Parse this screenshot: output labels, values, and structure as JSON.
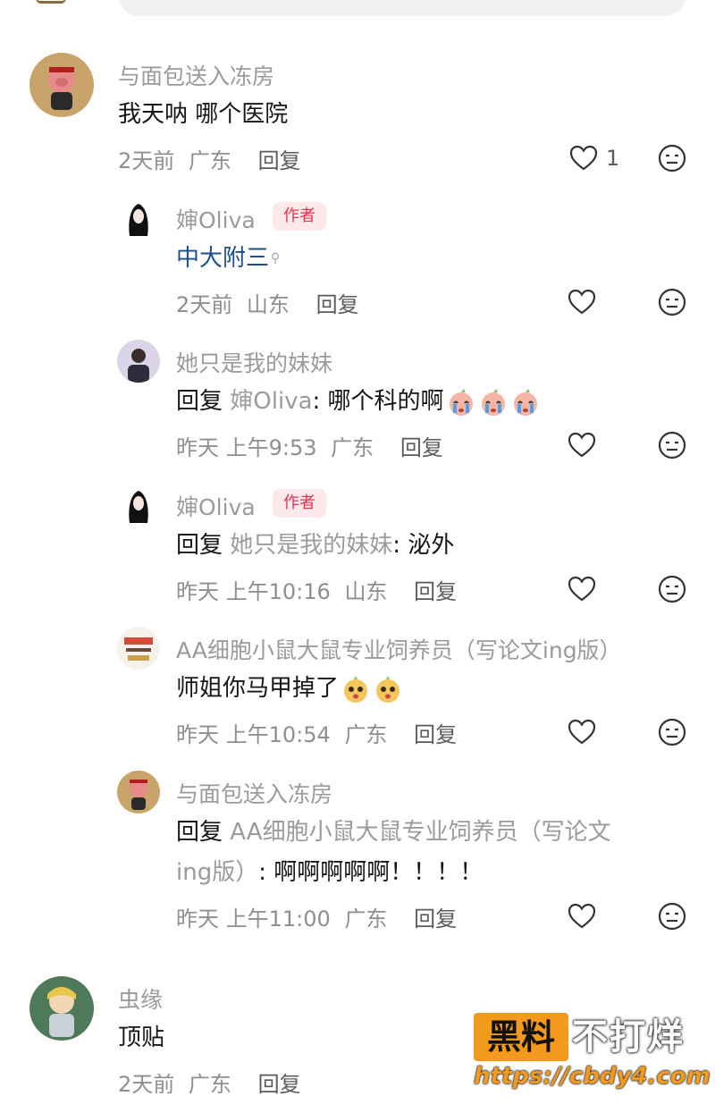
{
  "comments": [
    {
      "name": "与面包送入冻房",
      "text": "我天呐 哪个医院",
      "time": "2天前",
      "location": "广东",
      "reply_label": "回复",
      "likes": "1"
    },
    {
      "name": "婶Oliva",
      "author_tag": "作者",
      "text": "中大附三",
      "time": "2天前",
      "location": "山东",
      "reply_label": "回复"
    },
    {
      "name": "她只是我的妹妹",
      "reply_kw": "回复",
      "reply_target": "婶Oliva",
      "text": ": 哪个科的啊",
      "time": "昨天 上午9:53",
      "location": "广东",
      "reply_label": "回复"
    },
    {
      "name": "婶Oliva",
      "author_tag": "作者",
      "reply_kw": "回复",
      "reply_target": "她只是我的妹妹",
      "text": ": 泌外",
      "time": "昨天 上午10:16",
      "location": "山东",
      "reply_label": "回复"
    },
    {
      "name": "AA细胞小鼠大鼠专业饲养员（写论文ing版）",
      "text": "师姐你马甲掉了",
      "time": "昨天 上午10:54",
      "location": "广东",
      "reply_label": "回复"
    },
    {
      "name": "与面包送入冻房",
      "reply_kw": "回复",
      "reply_target_line1": "AA细胞小鼠大鼠专业饲养员（写论文",
      "reply_target_line2": "ing版）",
      "text": ": 啊啊啊啊啊！！！！",
      "time": "昨天 上午11:00",
      "location": "广东",
      "reply_label": "回复"
    },
    {
      "name": "虫缘",
      "text": "顶贴",
      "time": "2天前",
      "location": "广东",
      "reply_label": "回复"
    }
  ],
  "watermark": {
    "box_text": "黑料",
    "right_text": "不打烊",
    "url": "https://cbdy4.com"
  },
  "colors": {
    "author_tag_bg": "#fde9ec",
    "author_tag_fg": "#e8334f",
    "link": "#1f4e8c",
    "watermark_orange": "#f39a1d"
  },
  "icons": {
    "like": "heart-outline-icon",
    "dislike": "meh-face-icon",
    "search_hint": "search-icon"
  }
}
